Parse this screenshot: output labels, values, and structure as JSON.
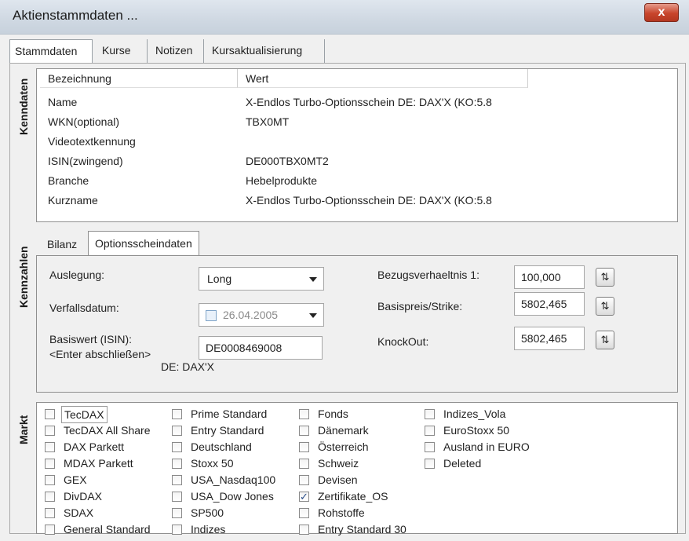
{
  "window": {
    "title": "Aktienstammdaten ...",
    "close_label": "x"
  },
  "tabs": [
    "Stammdaten",
    "Kurse",
    "Notizen",
    "Kursaktualisierung"
  ],
  "sections": {
    "kenndaten": "Kenndaten",
    "kennzahlen": "Kennzahlen",
    "markt": "Markt"
  },
  "kenndaten": {
    "headers": [
      "Bezeichnung",
      "Wert"
    ],
    "rows": [
      {
        "name": "Name",
        "value": "X-Endlos Turbo-Optionsschein DE: DAX'X (KO:5.8"
      },
      {
        "name": "WKN(optional)",
        "value": "TBX0MT"
      },
      {
        "name": "Videotextkennung",
        "value": ""
      },
      {
        "name": "ISIN(zwingend)",
        "value": "DE000TBX0MT2"
      },
      {
        "name": "Branche",
        "value": "Hebelprodukte"
      },
      {
        "name": "Kurzname",
        "value": "X-Endlos Turbo-Optionsschein DE: DAX'X (KO:5.8"
      }
    ]
  },
  "subtabs": [
    "Bilanz",
    "Optionsscheindaten"
  ],
  "optionsschein": {
    "auslegung_label": "Auslegung:",
    "auslegung_value": "Long",
    "verfall_label": "Verfallsdatum:",
    "verfall_value": "26.04.2005",
    "basiswert_label_1": "Basiswert (ISIN):",
    "basiswert_label_2": "<Enter abschließen>",
    "basiswert_value": "DE0008469008",
    "basiswert_name": "DE: DAX'X",
    "bezug_label": "Bezugsverhaeltnis 1:",
    "bezug_value": "100,000",
    "strike_label": "Basispreis/Strike:",
    "strike_value": "5802,465",
    "knockout_label": "KnockOut:",
    "knockout_value": "5802,465",
    "spin_glyph": "⇅"
  },
  "markt": {
    "columns": [
      [
        {
          "label": "TecDAX",
          "checked": false
        },
        {
          "label": "TecDAX All Share",
          "checked": false
        },
        {
          "label": "DAX Parkett",
          "checked": false
        },
        {
          "label": "MDAX Parkett",
          "checked": false
        },
        {
          "label": "GEX",
          "checked": false
        },
        {
          "label": "DivDAX",
          "checked": false
        },
        {
          "label": "SDAX",
          "checked": false
        },
        {
          "label": "General Standard",
          "checked": false
        }
      ],
      [
        {
          "label": "Prime Standard",
          "checked": false
        },
        {
          "label": "Entry Standard",
          "checked": false
        },
        {
          "label": "Deutschland",
          "checked": false
        },
        {
          "label": "Stoxx 50",
          "checked": false
        },
        {
          "label": "USA_Nasdaq100",
          "checked": false
        },
        {
          "label": "USA_Dow Jones",
          "checked": false
        },
        {
          "label": "SP500",
          "checked": false
        },
        {
          "label": "Indizes",
          "checked": false
        }
      ],
      [
        {
          "label": "Fonds",
          "checked": false
        },
        {
          "label": "Dänemark",
          "checked": false
        },
        {
          "label": "Österreich",
          "checked": false
        },
        {
          "label": "Schweiz",
          "checked": false
        },
        {
          "label": "Devisen",
          "checked": false
        },
        {
          "label": "Zertifikate_OS",
          "checked": true
        },
        {
          "label": "Rohstoffe",
          "checked": false
        },
        {
          "label": "Entry Standard 30",
          "checked": false
        }
      ],
      [
        {
          "label": "Indizes_Vola",
          "checked": false
        },
        {
          "label": "EuroStoxx 50",
          "checked": false
        },
        {
          "label": "Ausland in EURO",
          "checked": false
        },
        {
          "label": "Deleted",
          "checked": false
        }
      ]
    ]
  }
}
